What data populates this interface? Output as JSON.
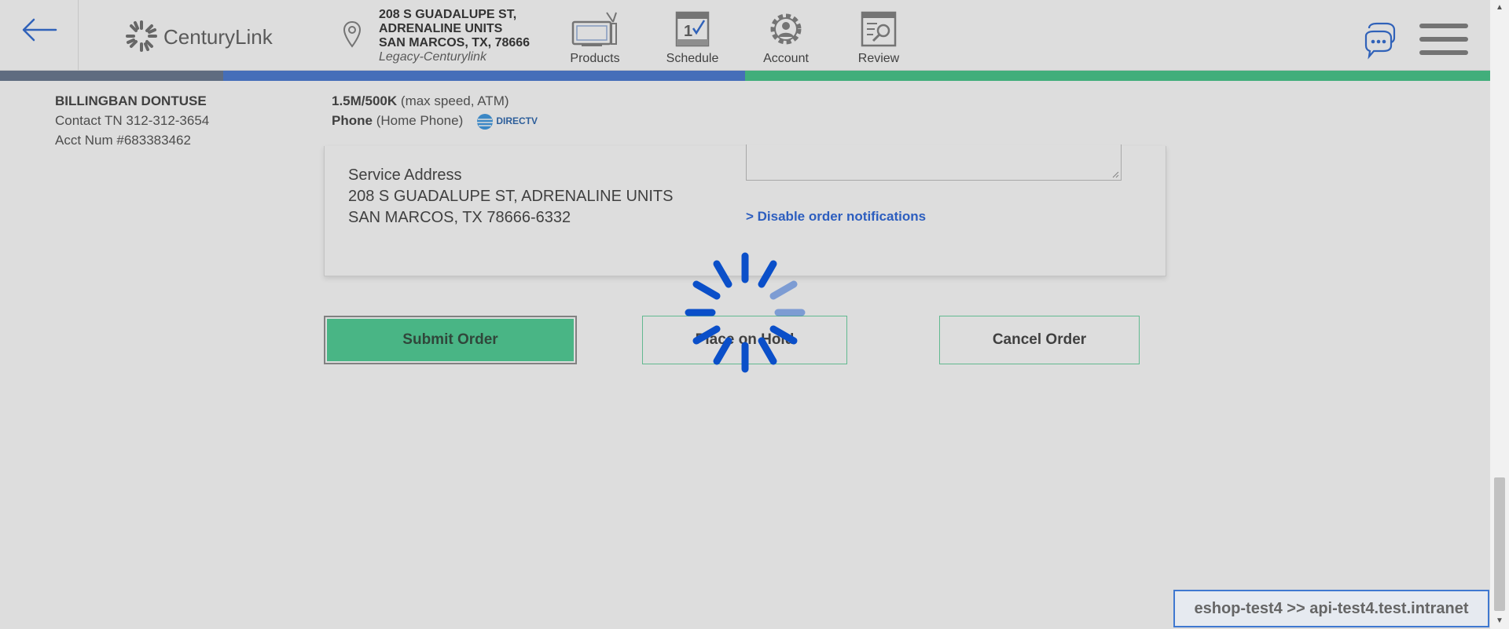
{
  "header": {
    "logo_text": "CenturyLink",
    "address": {
      "line1": "208 S GUADALUPE ST,",
      "line2": "ADRENALINE UNITS",
      "line3": "SAN MARCOS, TX, 78666",
      "legacy": "Legacy-Centurylink"
    },
    "nav": [
      {
        "label": "Products",
        "icon": "tv-icon"
      },
      {
        "label": "Schedule",
        "icon": "calendar-icon"
      },
      {
        "label": "Account",
        "icon": "account-gear-icon"
      },
      {
        "label": "Review",
        "icon": "review-icon"
      }
    ]
  },
  "progress": {
    "segments": 3,
    "colors": [
      "#5b6d86",
      "#3a6fd0",
      "#35c280"
    ]
  },
  "customer": {
    "name": "BILLINGBAN DONTUSE",
    "contact": "Contact TN 312-312-3654",
    "acct": "Acct Num #683383462"
  },
  "service": {
    "speed_bold": "1.5M/500K",
    "speed_rest": "(max speed, ATM)",
    "phone_bold": "Phone",
    "phone_rest": "(Home Phone)",
    "directv": "DIRECTV"
  },
  "panel": {
    "svc_label": "Service Address",
    "svc_line1": "208 S GUADALUPE ST, ADRENALINE UNITS",
    "svc_line2": "SAN MARCOS, TX 78666-6332",
    "disable_link": "> Disable order notifications"
  },
  "buttons": {
    "submit": "Submit Order",
    "hold": "Place on Hold",
    "cancel": "Cancel Order"
  },
  "env": "eshop-test4 >> api-test4.test.intranet",
  "colors": {
    "accent_blue": "#1a5ad8",
    "accent_green": "#3fcb8d",
    "spinner": "#0a4fc9"
  }
}
